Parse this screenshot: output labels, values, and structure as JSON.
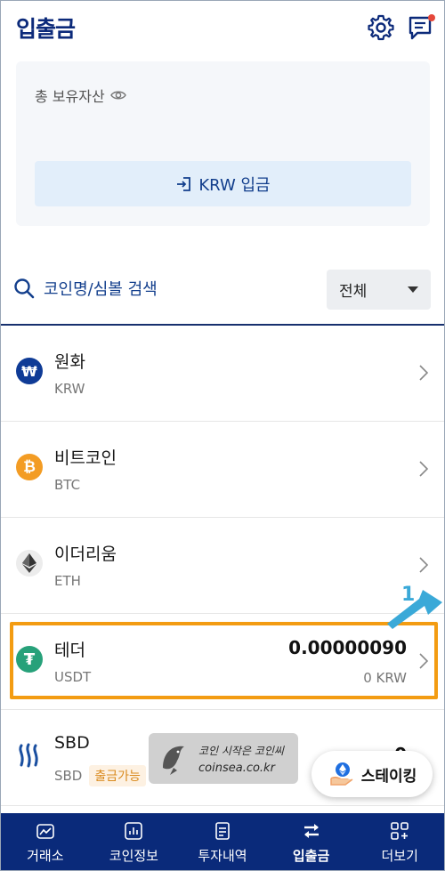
{
  "header": {
    "title": "입출금",
    "settings_icon": "gear-icon",
    "notice_icon": "chat-notice-icon"
  },
  "asset_card": {
    "label": "총 보유자산",
    "deposit_button": "KRW 입금"
  },
  "search": {
    "label": "코인명/심볼 검색",
    "filter_value": "전체"
  },
  "coins": [
    {
      "name": "원화",
      "symbol": "KRW",
      "amount": "",
      "krw_value": "",
      "tag": "",
      "icon_color": "#0f3b96"
    },
    {
      "name": "비트코인",
      "symbol": "BTC",
      "amount": "",
      "krw_value": "",
      "tag": "",
      "icon_color": "#f39c24"
    },
    {
      "name": "이더리움",
      "symbol": "ETH",
      "amount": "",
      "krw_value": "",
      "tag": "",
      "icon_color": "#ececec"
    },
    {
      "name": "테더",
      "symbol": "USDT",
      "amount": "0.00000090",
      "krw_value": "0 KRW",
      "tag": "",
      "icon_color": "#27a17a"
    },
    {
      "name": "SBD",
      "symbol": "SBD",
      "amount": "0",
      "krw_value": "",
      "tag": "출금가능",
      "icon_color": "#1a4fa0"
    }
  ],
  "annotation": {
    "number": "1",
    "color": "#3aa9d8"
  },
  "watermark": {
    "line1": "코인 시작은 코인씨",
    "line2": "coinsea.co.kr"
  },
  "staking": {
    "label": "스테이킹"
  },
  "nav": [
    {
      "label": "거래소",
      "icon": "exchange-icon",
      "active": false
    },
    {
      "label": "코인정보",
      "icon": "chart-icon",
      "active": false
    },
    {
      "label": "투자내역",
      "icon": "document-icon",
      "active": false
    },
    {
      "label": "입출금",
      "icon": "transfer-icon",
      "active": true
    },
    {
      "label": "더보기",
      "icon": "more-icon",
      "active": false
    }
  ],
  "colors": {
    "brand_navy": "#0a2a7a",
    "highlight": "#f39c12"
  }
}
